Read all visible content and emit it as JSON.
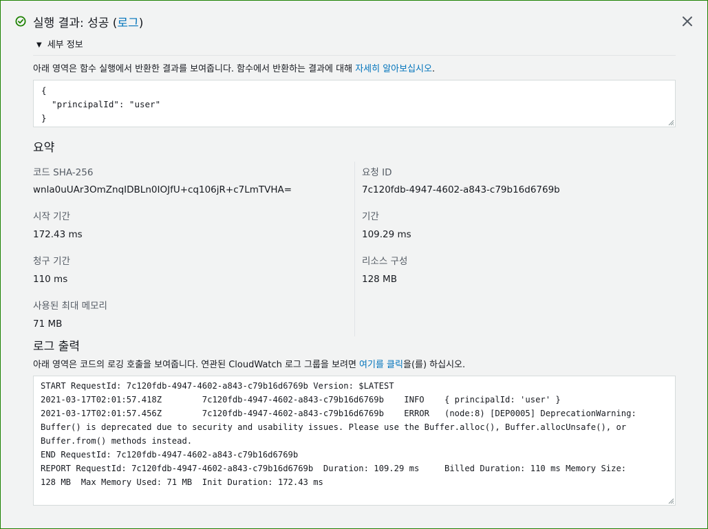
{
  "colors": {
    "success": "#1d8102",
    "link": "#0073bb"
  },
  "header": {
    "icon": "check-circle-icon",
    "title_prefix": "실행 결과: 성공 (",
    "title_link": "로그",
    "title_suffix": ")",
    "close_icon": "close-icon"
  },
  "details": {
    "toggle_icon": "caret-down-icon",
    "label": "세부 정보",
    "description_prefix": "아래 영역은 함수 실행에서 반환한 결과를 보여줍니다. 함수에서 반환하는 결과에 대해 ",
    "description_link": "자세히 알아보십시오",
    "description_suffix": ".",
    "result_lines": [
      "{",
      "  \"principalId\": \"user\"",
      "}"
    ]
  },
  "summary": {
    "title": "요약",
    "fields": [
      {
        "label": "코드 SHA-256",
        "value": "wnla0uUAr3OmZnqIDBLn0IOJfU+cq106jR+c7LmTVHA="
      },
      {
        "label": "요청 ID",
        "value": "7c120fdb-4947-4602-a843-c79b16d6769b"
      },
      {
        "label": "시작 기간",
        "value": "172.43 ms"
      },
      {
        "label": "기간",
        "value": "109.29 ms"
      },
      {
        "label": "청구 기간",
        "value": "110 ms"
      },
      {
        "label": "리소스 구성",
        "value": "128 MB"
      },
      {
        "label": "사용된 최대 메모리",
        "value": "71 MB"
      }
    ]
  },
  "log": {
    "title": "로그 출력",
    "description_prefix": "아래 영역은 코드의 로깅 호출을 보여줍니다. 연관된 CloudWatch 로그 그룹을 보려면 ",
    "description_link": "여기를 클릭",
    "description_suffix": "을(를) 하십시오.",
    "lines": [
      "START RequestId: 7c120fdb-4947-4602-a843-c79b16d6769b Version: $LATEST",
      "2021-03-17T02:01:57.418Z        7c120fdb-4947-4602-a843-c79b16d6769b    INFO    { principalId: 'user' }",
      "2021-03-17T02:01:57.456Z        7c120fdb-4947-4602-a843-c79b16d6769b    ERROR   (node:8) [DEP0005] DeprecationWarning:",
      "Buffer() is deprecated due to security and usability issues. Please use the Buffer.alloc(), Buffer.allocUnsafe(), or",
      "Buffer.from() methods instead.",
      "END RequestId: 7c120fdb-4947-4602-a843-c79b16d6769b",
      "REPORT RequestId: 7c120fdb-4947-4602-a843-c79b16d6769b  Duration: 109.29 ms     Billed Duration: 110 ms Memory Size:",
      "128 MB  Max Memory Used: 71 MB  Init Duration: 172.43 ms"
    ]
  }
}
